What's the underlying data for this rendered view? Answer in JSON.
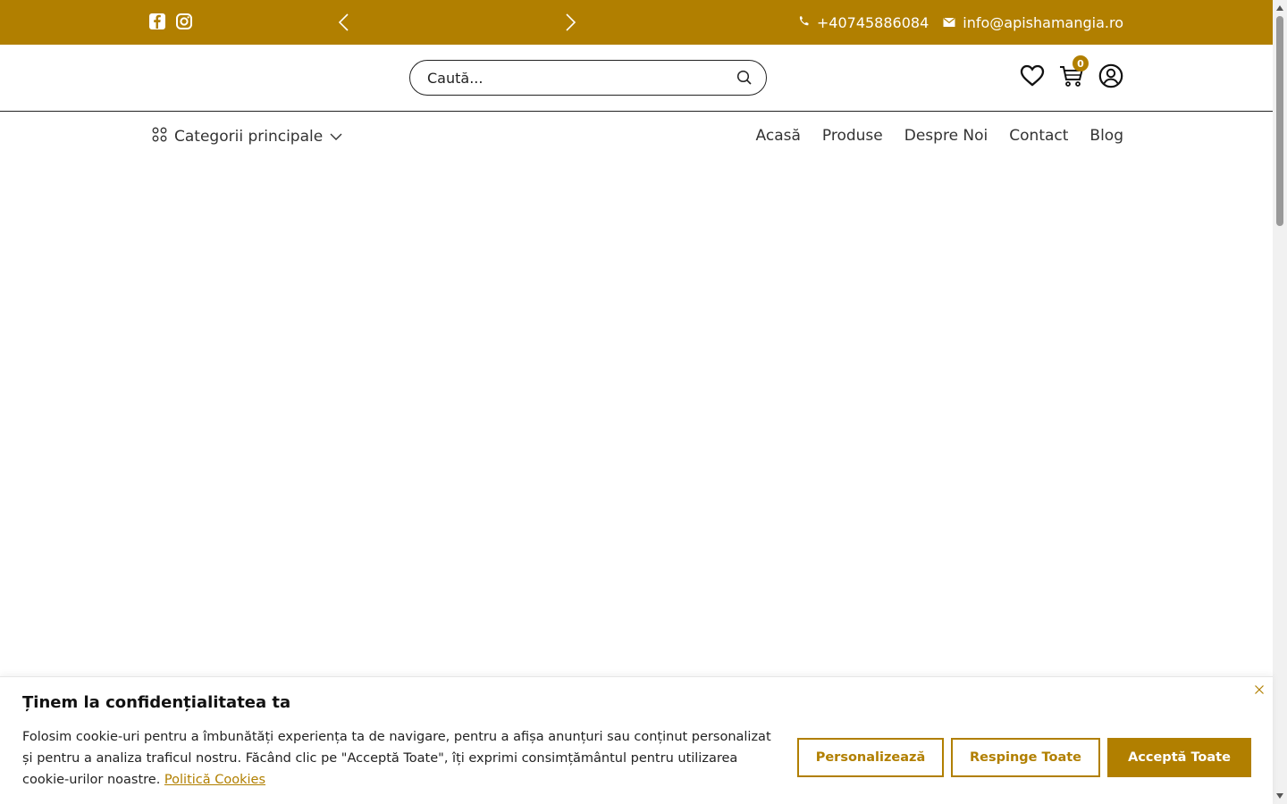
{
  "topbar": {
    "phone": "+40745886084",
    "email": "info@apishamangia.ro",
    "icons": [
      "facebook-icon",
      "instagram-icon",
      "chevron-left-icon",
      "chevron-right-icon",
      "phone-icon",
      "mail-icon"
    ]
  },
  "header": {
    "search_placeholder": "Caută...",
    "cart_count": "0",
    "icons": [
      "search-icon",
      "heart-icon",
      "cart-icon",
      "user-icon"
    ]
  },
  "nav": {
    "categories_label": "Categorii principale",
    "items": [
      "Acasă",
      "Produse",
      "Despre Noi",
      "Contact",
      "Blog"
    ]
  },
  "cookie": {
    "title": "Ținem la confidențialitatea ta",
    "text": "Folosim cookie-uri pentru a îmbunătăți experiența ta de navigare, pentru a afișa anunțuri sau conținut personalizat și pentru a analiza traficul nostru. Făcând clic pe \"Acceptă Toate\", îți exprimi consimțământul pentru utilizarea cookie-urilor noastre.",
    "policy_link": "Politică Cookies",
    "customize_label": "Personalizează",
    "reject_label": "Respinge Toate",
    "accept_label": "Acceptă Toate"
  },
  "colors": {
    "brand": "#b17f00",
    "text": "#222222",
    "background": "#ffffff"
  }
}
